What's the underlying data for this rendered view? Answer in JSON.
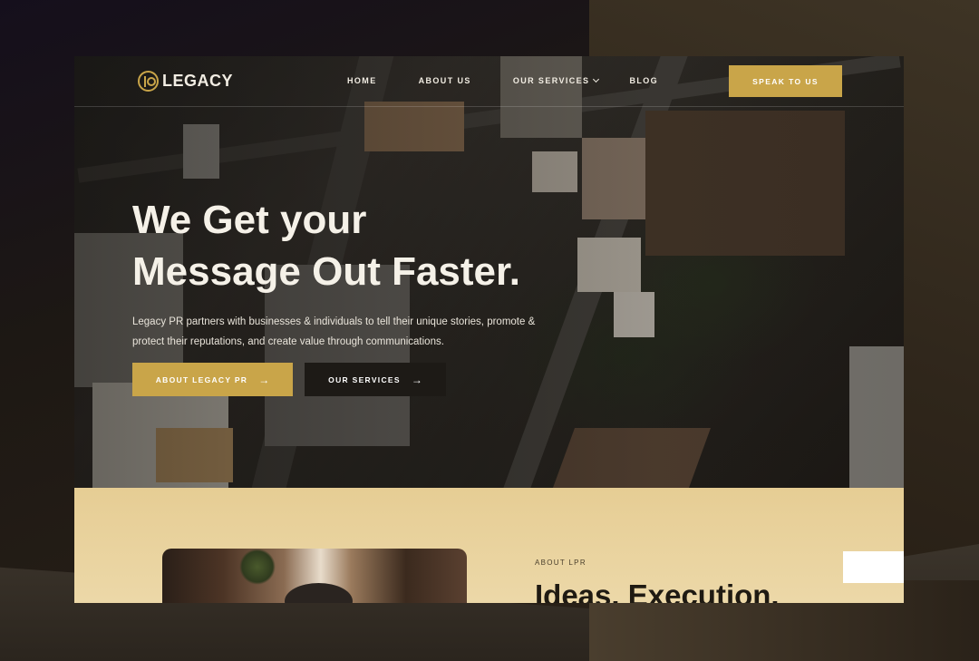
{
  "brand": {
    "name": "LEGACY",
    "accent": "#c9a549"
  },
  "nav": {
    "items": [
      {
        "label": "HOME"
      },
      {
        "label": "ABOUT US"
      },
      {
        "label": "OUR SERVICES",
        "has_dropdown": true
      },
      {
        "label": "BLOG"
      }
    ],
    "cta_label": "SPEAK TO US"
  },
  "hero": {
    "title_line1": "We Get your",
    "title_line2": "Message Out Faster.",
    "subtitle": "Legacy PR partners with businesses & individuals to tell their unique stories, promote & protect their reputations, and create value through communications.",
    "primary_button": "ABOUT LEGACY PR",
    "secondary_button": "OUR SERVICES",
    "arrow_icon": "arrow-right-icon"
  },
  "about": {
    "label": "ABOUT LPR",
    "title": "Ideas. Execution."
  }
}
